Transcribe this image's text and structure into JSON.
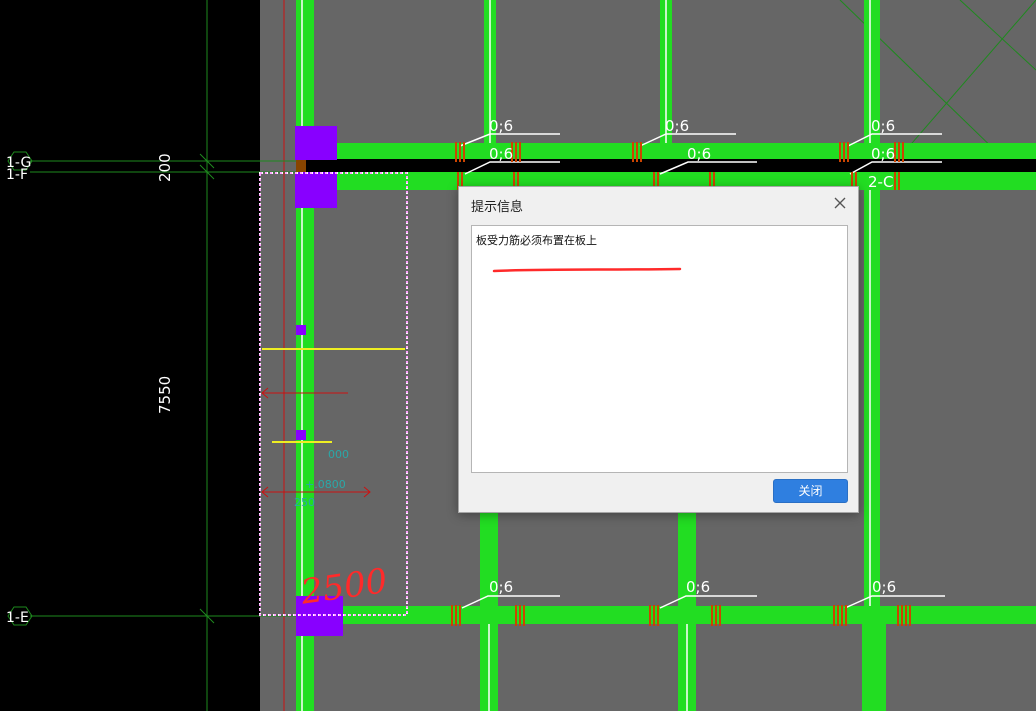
{
  "colors": {
    "canvas_bg": "#000000",
    "slab_fill": "#666666",
    "beam": "#22dd22",
    "column": "#8800ff",
    "axis_line": "#1e8a1e",
    "rebar_tick": "#cc4400",
    "leader": "#ffffff",
    "accent_button": "#2f7fe0",
    "annotation_red": "#ff2a2a"
  },
  "axes": {
    "g": "1-G",
    "f": "1-F",
    "e": "1-E",
    "c": "2-C"
  },
  "dimensions": {
    "top": "200",
    "middle": "7550"
  },
  "beam_labels": {
    "top_row_1": [
      "0;6",
      "0;6",
      "0;6"
    ],
    "top_row_2": [
      "0;6",
      "0;6",
      "0;6"
    ],
    "bottom_row": [
      "0;6",
      "0;6",
      "0;6"
    ]
  },
  "detail_labels": {
    "cyan_1": "000",
    "cyan_2": "+.0800",
    "cyan_3": "250"
  },
  "handwritten": "2500",
  "dialog": {
    "title": "提示信息",
    "message": "板受力筋必须布置在板上",
    "close_label": "关闭"
  }
}
